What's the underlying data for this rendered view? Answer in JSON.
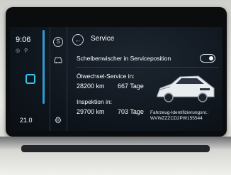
{
  "status": {
    "time": "9:06",
    "temperature": "21.0"
  },
  "service": {
    "title": "Service",
    "wiper": {
      "label": "Scheibenwischer in Serviceposition",
      "enabled": false
    },
    "oil": {
      "label": "Ölwechsel-Service in:",
      "km": "28200 km",
      "days": "667 Tage"
    },
    "inspection": {
      "label": "Inspektion in:",
      "km": "29700 km",
      "days": "703 Tage"
    },
    "vehicle": {
      "vin_label": "Fahrzeug-Identifizierungsnr.:",
      "vin": "WVWZZZCD2PW155544"
    }
  },
  "icons": {
    "back": "back-arrow-icon",
    "service": "service-s-icon",
    "car_settings": "car-settings-icon",
    "settings": "gear-icon",
    "home": "home-square-icon"
  },
  "colors": {
    "accent": "#38c6e6",
    "rail": "#2f9bd1",
    "screen_bg": "#0e141b"
  }
}
